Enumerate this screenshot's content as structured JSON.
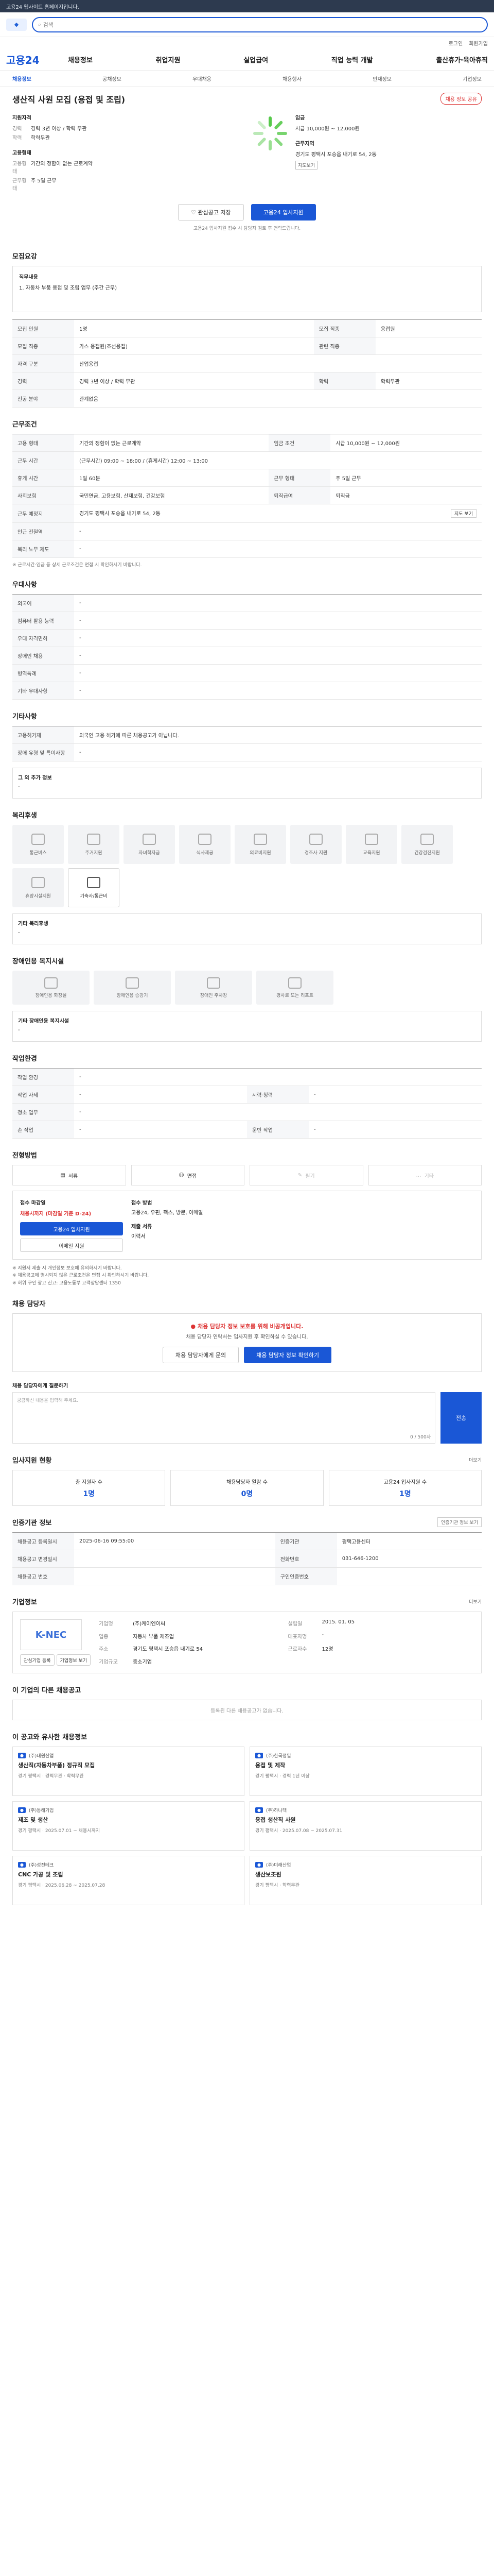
{
  "top_notice": "고용24 웹사이트 홈페이지입니다.",
  "search": {
    "placeholder": "검색"
  },
  "util": [
    "로그인",
    "회원가입"
  ],
  "gnb": {
    "brand": "고용24",
    "menu": [
      "채용정보",
      "취업지원",
      "실업급여",
      "직업 능력 개발",
      "출산휴가·육아휴직"
    ]
  },
  "subnav": [
    "채용정보",
    "공채정보",
    "우대채용",
    "채용행사",
    "인재정보",
    "기업정보"
  ],
  "job": {
    "title": "생산직 사원 모집 (용접 및 조립)",
    "share_label": "채용 정보 공유",
    "qualify_head": "지원자격",
    "qualify": [
      {
        "k": "경력",
        "v": "경력 3년 이상 / 학력 무관"
      },
      {
        "k": "학력",
        "v": "학력무관"
      }
    ],
    "employ_head": "고용형태",
    "employ": [
      {
        "k": "고용형태",
        "v": "기간의 정함이 없는 근로계약"
      },
      {
        "k": "근무형태",
        "v": "주 5일 근무"
      }
    ],
    "pay_head": "임금",
    "pay_values": [
      "시급 10,000원 ~ 12,000원"
    ],
    "place_head": "근무지역",
    "place_value": "경기도 평택시 포승읍 내기로 54, 2동",
    "place_tag": "지도보기",
    "interest_btn": "관심공고 저장",
    "apply_btn": "고용24 입사지원",
    "apply_note": "고용24 입사지원 접수 시 담당자 검토 후 연락드립니다."
  },
  "sections": {
    "duty": {
      "title": "모집요강",
      "label": "직무내용",
      "text": "1. 자동차 부품 용접 및 조립 업무 (주간 근무)"
    },
    "recruit_table": {
      "rows": [
        [
          "모집 인원",
          "1명",
          "모집 직종",
          "용접원"
        ],
        [
          "모집 직종",
          "가스 용접원(조선용접)",
          "관련 직종",
          ""
        ],
        [
          "자격 구분",
          "산업용접",
          "",
          ""
        ],
        [
          "경력",
          "경력 3년 이상 / 학력 무관",
          "학력",
          "학력무관"
        ],
        [
          "전공 분야",
          "관계없음",
          "",
          ""
        ]
      ]
    },
    "work": {
      "title": "근무조건",
      "rows": [
        [
          "고용 형태",
          "기간의 정함이 없는 근로계약",
          "임금 조건",
          "시급 10,000원 ~ 12,000원"
        ],
        [
          "근무 시간",
          "(근무시간) 09:00 ~ 18:00 / (휴게시간) 12:00 ~ 13:00",
          "",
          ""
        ],
        [
          "휴게 시간",
          "1일 60분",
          "근무 형태",
          "주 5일 근무"
        ],
        [
          "사회보험",
          "국민연금, 고용보험, 산재보험, 건강보험",
          "퇴직급여",
          "퇴직금"
        ],
        [
          "근무 예정지",
          "경기도 평택시 포승읍 내기로 54, 2동",
          "",
          ""
        ],
        [
          "인근 전철역",
          "-",
          "",
          ""
        ],
        [
          "복리 노무 제도",
          "-",
          "",
          ""
        ]
      ],
      "map_btn": "지도 보기",
      "note": "※ 근로시간·임금 등 상세 근로조건은 면접 시 확인하시기 바랍니다."
    },
    "pref": {
      "title": "우대사항",
      "rows": [
        [
          "외국어",
          "-"
        ],
        [
          "컴퓨터 활용 능력",
          "-"
        ],
        [
          "우대 자격면허",
          "-"
        ],
        [
          "장애인 채용",
          "-"
        ],
        [
          "병역특례",
          "-"
        ],
        [
          "기타 우대사항",
          "-"
        ]
      ]
    },
    "etc": {
      "title": "기타사항",
      "rows": [
        [
          "고용허가제",
          "외국인 고용 허가에 따른 채용공고가 아닙니다."
        ],
        [
          "장애 유형 및 특이사항",
          "-"
        ]
      ],
      "box_label": "그 외 추가 정보",
      "box_text": "-"
    },
    "welfare": {
      "title": "복리후생",
      "items": [
        "통근버스",
        "주거지원",
        "자녀학자금",
        "식사제공",
        "의료비지원",
        "경조사 지원",
        "교육지원",
        "건강검진지원",
        "휴양시설지원",
        "기숙사/통근비"
      ],
      "box_label": "기타 복리후생",
      "box_text": "-"
    },
    "disabled": {
      "title": "장애인용 복지시설",
      "items": [
        "장애인용 화장실",
        "장애인용 승강기",
        "장애인 주차장",
        "경사로 또는 리프트"
      ],
      "box_label": "기타 장애인용 복지시설",
      "box_text": "-"
    },
    "env": {
      "title": "작업환경",
      "rows": [
        [
          "작업 환경",
          "-",
          "",
          ""
        ],
        [
          "작업 자세",
          "-",
          "시력·청력",
          "-"
        ],
        [
          "청소 업무",
          "-",
          "",
          ""
        ],
        [
          "손 작업",
          "-",
          "운반 작업",
          "-"
        ]
      ]
    },
    "method": {
      "title": "전형방법",
      "steps": [
        "서류",
        "면접",
        "필기",
        "기타"
      ],
      "step_off": [
        false,
        false,
        true,
        true
      ]
    },
    "apply": {
      "head": "접수 마감일",
      "deadline": "채용시까지 (마감일 기준 D-24)",
      "apply_btn": "고용24 입사지원",
      "email_btn": "이메일 지원",
      "method_head": "접수 방법",
      "method_text": "고용24, 우편, 팩스, 방문, 이메일",
      "docs_head": "제출 서류",
      "docs_text": "이력서",
      "notes": [
        "※ 지원서 제출 시 개인정보 보호에 유의하시기 바랍니다.",
        "※ 채용공고에 명시되지 않은 근로조건은 면접 시 확인하시기 바랍니다.",
        "※ 허위 구인 광고 신고: 고용노동부 고객상담센터 1350"
      ]
    },
    "contact": {
      "title": "채용 담당자",
      "warn": "채용 담당자 정보 보호를 위해 비공개입니다.",
      "text": "채용 담당자 연락처는 입사지원 후 확인하실 수 있습니다.",
      "btn_a": "채용 담당자에게 문의",
      "btn_b": "채용 담당자 정보 확인하기",
      "ask_label": "채용 담당자에게 질문하기",
      "ask_placeholder": "궁금하신 내용을 입력해 주세요.",
      "ask_btn": "전송",
      "ask_count": "0 / 500자"
    },
    "status": {
      "title": "입사지원 현황",
      "link": "더보기",
      "items": [
        {
          "label": "총 지원자 수",
          "value": "1명"
        },
        {
          "label": "채용담당자 열람 수",
          "value": "0명"
        },
        {
          "label": "고용24 입사지원 수",
          "value": "1명"
        }
      ]
    },
    "info": {
      "title": "인증기관 정보",
      "link": "인증기관 정보 보기",
      "rows": [
        [
          "채용공고 등록일시",
          "2025-06-16 09:55:00",
          "인증기관",
          "평택고용센터"
        ],
        [
          "채용공고 변경일시",
          "",
          "전화번호",
          "031-646-1200"
        ],
        [
          "채용공고 번호",
          "",
          "구인인증번호",
          ""
        ]
      ]
    },
    "company": {
      "title": "기업정보",
      "link": "더보기",
      "logo": "K-NEC",
      "fields": [
        [
          "기업명",
          "(주)케이엔이씨",
          "설립일",
          "2015. 01. 05"
        ],
        [
          "업종",
          "자동차 부품 제조업",
          "대표자명",
          "-"
        ],
        [
          "주소",
          "경기도 평택시 포승읍 내기로 54",
          "근로자수",
          "12명"
        ],
        [
          "기업규모",
          "중소기업",
          "",
          ""
        ]
      ],
      "btn_a": "관심기업 등록",
      "btn_b": "기업정보 보기"
    },
    "same": {
      "title": "이 기업의 다른 채용공고",
      "empty": "등록된 다른 채용공고가 없습니다."
    },
    "rec": {
      "title": "이 공고와 유사한 채용정보",
      "cards": [
        {
          "co": "(주)대원산업",
          "t": "생산직(자동차부품) 정규직 모집",
          "m": "경기 평택시 · 경력무관 · 학력무관"
        },
        {
          "co": "(주)한국정밀",
          "t": "용접 및 제작",
          "m": "경기 평택시 · 경력 1년 이상"
        },
        {
          "co": "(주)동해기업",
          "t": "제조 및 생산",
          "m": "경기 평택시 · 2025.07.01 ~ 채용시까지"
        },
        {
          "co": "(주)하나텍",
          "t": "용접 생산직 사원",
          "m": "경기 평택시 · 2025.07.08 ~ 2025.07.31"
        },
        {
          "co": "(주)성진테크",
          "t": "CNC 가공 및 조립",
          "m": "경기 평택시 · 2025.06.28 ~ 2025.07.28"
        },
        {
          "co": "(주)미래산업",
          "t": "생산보조원",
          "m": "경기 평택시 · 학력무관"
        }
      ]
    }
  }
}
